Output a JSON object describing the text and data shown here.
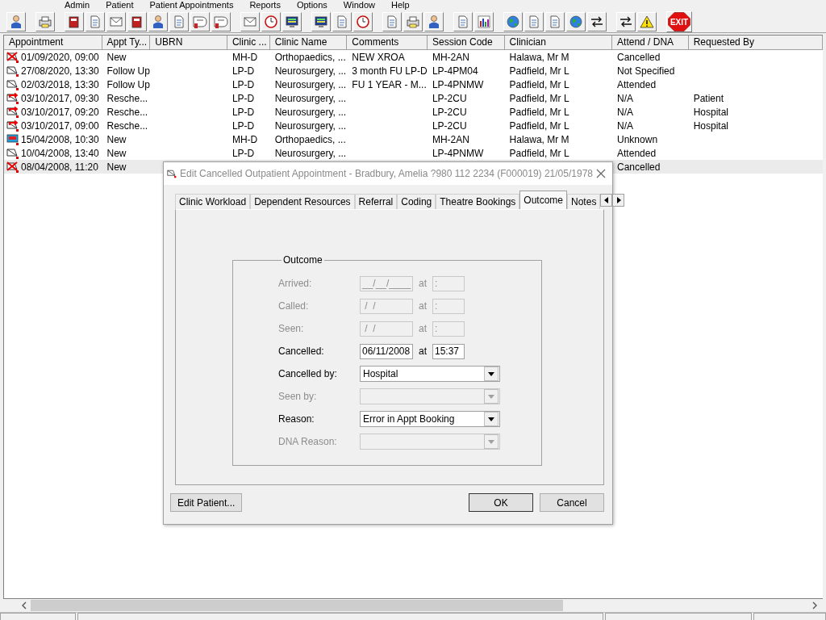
{
  "menu": [
    "Admin",
    "Patient",
    "Patient Appointments",
    "Reports",
    "Options",
    "Window",
    "Help"
  ],
  "exit_label": "EXIT",
  "table": {
    "columns": [
      "Appointment",
      "Appt Ty...",
      "UBRN",
      "Clinic ...",
      "Clinic Name",
      "Comments",
      "Session Code",
      "Clinician",
      "Attend / DNA",
      "Requested By"
    ],
    "rows": [
      {
        "kind": "cancelled",
        "selected": false,
        "cells": [
          "01/09/2020, 09:00",
          "New",
          "",
          "MH-D",
          "Orthopaedics, ...",
          "NEW XROA",
          "MH-2AN",
          "Halawa, Mr M",
          "Cancelled",
          ""
        ]
      },
      {
        "kind": "letter",
        "selected": false,
        "cells": [
          "27/08/2020, 13:30",
          "Follow Up",
          "",
          "LP-D",
          "Neurosurgery, ...",
          "3 month FU LP-D",
          "LP-4PM04",
          "Padfield, Mr L",
          "Not Specified",
          ""
        ]
      },
      {
        "kind": "letter",
        "selected": false,
        "cells": [
          "02/03/2018, 13:30",
          "Follow Up",
          "",
          "LP-D",
          "Neurosurgery, ...",
          "FU 1 YEAR - M...",
          "LP-4PNMW",
          "Padfield, Mr L",
          "Attended",
          ""
        ]
      },
      {
        "kind": "rescheduled",
        "selected": false,
        "cells": [
          "03/10/2017, 09:30",
          "Resche...",
          "",
          "LP-D",
          "Neurosurgery, ...",
          "",
          "LP-2CU",
          "Padfield, Mr L",
          "N/A",
          "Patient"
        ]
      },
      {
        "kind": "rescheduled",
        "selected": false,
        "cells": [
          "03/10/2017, 09:20",
          "Resche...",
          "",
          "LP-D",
          "Neurosurgery, ...",
          "",
          "LP-2CU",
          "Padfield, Mr L",
          "N/A",
          "Hospital"
        ]
      },
      {
        "kind": "rescheduled",
        "selected": false,
        "cells": [
          "03/10/2017, 09:00",
          "Resche...",
          "",
          "LP-D",
          "Neurosurgery, ...",
          "",
          "LP-2CU",
          "Padfield, Mr L",
          "N/A",
          "Hospital"
        ]
      },
      {
        "kind": "dna",
        "selected": false,
        "cells": [
          "15/04/2008, 10:30",
          "New",
          "",
          "MH-D",
          "Orthopaedics, ...",
          "",
          "MH-2AN",
          "Halawa, Mr M",
          "Unknown",
          ""
        ]
      },
      {
        "kind": "letter",
        "selected": false,
        "cells": [
          "10/04/2008, 13:40",
          "New",
          "",
          "LP-D",
          "Neurosurgery, ...",
          "",
          "LP-4PNMW",
          "Padfield, Mr L",
          "Attended",
          ""
        ]
      },
      {
        "kind": "cancelled",
        "selected": true,
        "cells": [
          "08/04/2008, 11:20",
          "New",
          "",
          "",
          "",
          "",
          "",
          "",
          "Cancelled",
          ""
        ]
      }
    ]
  },
  "dialog": {
    "title": "Edit Cancelled Outpatient Appointment - Bradbury, Amelia ?980 112 2234 (F000019) 21/05/1978",
    "tabs": [
      {
        "label": "Clinic Workload",
        "selected": false
      },
      {
        "label": "Dependent Resources",
        "selected": false
      },
      {
        "label": "Referral",
        "selected": false
      },
      {
        "label": "Coding",
        "selected": false
      },
      {
        "label": "Theatre Bookings",
        "selected": false
      },
      {
        "label": "Outcome",
        "selected": true
      },
      {
        "label": "Notes",
        "selected": false
      }
    ],
    "group_title": "Outcome",
    "date_rows": [
      {
        "label": "Arrived:",
        "disabled": true,
        "date": "__/__/____",
        "at": "at",
        "time": ":"
      },
      {
        "label": "Called:",
        "disabled": true,
        "date": " /  /",
        "at": "at",
        "time": ":"
      },
      {
        "label": "Seen:",
        "disabled": true,
        "date": " /  /",
        "at": "at",
        "time": ":"
      },
      {
        "label": "Cancelled:",
        "disabled": false,
        "date": "06/11/2008",
        "at": "at",
        "time": "15:37"
      }
    ],
    "combo_rows": [
      {
        "label": "Cancelled by:",
        "disabled": false,
        "value": "Hospital"
      },
      {
        "label": "Seen by:",
        "disabled": true,
        "value": ""
      },
      {
        "label": "Reason:",
        "disabled": false,
        "value": "Error in Appt Booking"
      },
      {
        "label": "DNA Reason:",
        "disabled": true,
        "value": ""
      }
    ],
    "left_button": "Edit Patient...",
    "buttons": [
      "OK",
      "Cancel"
    ]
  }
}
